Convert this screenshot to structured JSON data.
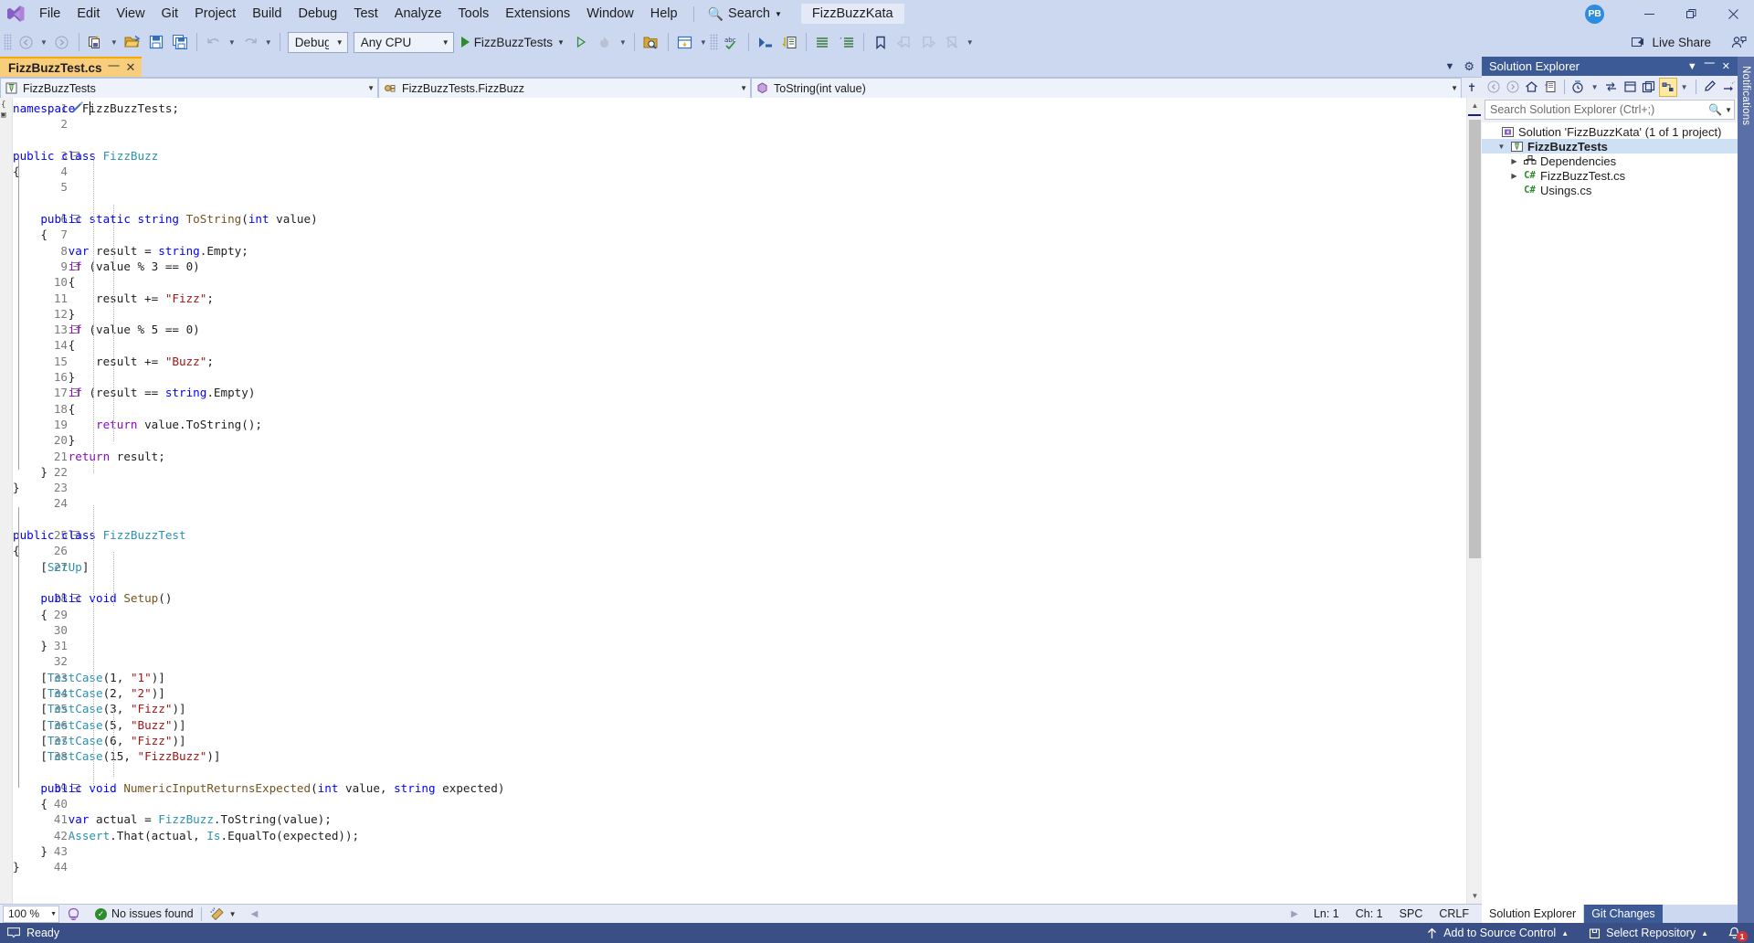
{
  "titlebar": {
    "logo_icon": "visual-studio-logo",
    "menus": [
      "File",
      "Edit",
      "View",
      "Git",
      "Project",
      "Build",
      "Debug",
      "Test",
      "Analyze",
      "Tools",
      "Extensions",
      "Window",
      "Help"
    ],
    "search": {
      "icon": "search-icon",
      "label": "Search",
      "caret": "▾"
    },
    "project_chip": "FizzBuzzKata",
    "avatar_initials": "PB",
    "window_controls": {
      "minimize": "—",
      "restore": "❐",
      "close": "✕"
    }
  },
  "toolbar": {
    "back_label": "◄",
    "forward_label": "►",
    "new_project_icon": "new-project-icon",
    "open_file_icon": "open-file-icon",
    "save_icon": "save-icon",
    "save_all_icon": "save-all-icon",
    "undo_icon": "undo-icon",
    "redo_icon": "redo-icon",
    "config_value": "Debug",
    "platform_value": "Any CPU",
    "start_label": "FizzBuzzTests",
    "start_icon": "play-icon",
    "start_no_debug_icon": "play-outline-icon",
    "hot_reload_icon": "hot-reload-icon",
    "find_in_files_icon": "find-in-files-icon",
    "window_layout_icon": "window-layout-icon",
    "spell_check_icon": "spell-check-icon",
    "step_icon": "step-into-icon",
    "indent_icon": "indent-icon",
    "comment_icon": "comment-icon",
    "uncomment_icon": "uncomment-icon",
    "bookmark_icon": "bookmark-icon",
    "bookmark_prev_icon": "bookmark-prev-icon",
    "bookmark_next_icon": "bookmark-next-icon",
    "bookmark_clear_icon": "bookmark-clear-icon",
    "overflow_label": "▾",
    "live_share": {
      "icon": "live-share-icon",
      "label": "Live Share",
      "participants_icon": "participants-icon"
    }
  },
  "editor": {
    "tab": {
      "title": "FizzBuzzTest.cs",
      "pin_icon": "pin-icon",
      "close_icon": "close-icon"
    },
    "tabstrip_right": {
      "dropdown_icon": "chevron-down-icon",
      "settings_icon": "gear-icon"
    },
    "navbar": {
      "project": {
        "icon": "project-icon",
        "value": "FizzBuzzTests"
      },
      "type": {
        "icon": "class-icon",
        "value": "FizzBuzzTests.FizzBuzz"
      },
      "member": {
        "icon": "method-icon",
        "value": "ToString(int value)"
      },
      "split_icon": "split-view-icon"
    },
    "caret_line": 1,
    "code_lines": [
      {
        "n": 1,
        "fold": null,
        "tokens": [
          [
            "kw",
            "namespace"
          ],
          [
            "plain",
            " FizzBuzzTests;"
          ]
        ]
      },
      {
        "n": 2,
        "fold": null,
        "tokens": []
      },
      {
        "n": "",
        "fold": null,
        "tokens": []
      },
      {
        "n": 3,
        "fold": "minus",
        "tokens": [
          [
            "kw",
            "public class "
          ],
          [
            "type",
            "FizzBuzz"
          ]
        ]
      },
      {
        "n": 4,
        "fold": null,
        "tokens": [
          [
            "plain",
            "{"
          ]
        ]
      },
      {
        "n": 5,
        "fold": null,
        "tokens": []
      },
      {
        "n": "",
        "fold": null,
        "tokens": []
      },
      {
        "n": 6,
        "fold": "minus",
        "tokens": [
          [
            "plain",
            "    "
          ],
          [
            "kw",
            "public static string "
          ],
          [
            "meth",
            "ToString"
          ],
          [
            "plain",
            "("
          ],
          [
            "kw",
            "int"
          ],
          [
            "plain",
            " value)"
          ]
        ]
      },
      {
        "n": 7,
        "fold": null,
        "tokens": [
          [
            "plain",
            "    {"
          ]
        ]
      },
      {
        "n": 8,
        "fold": null,
        "tokens": [
          [
            "plain",
            "        "
          ],
          [
            "kw",
            "var"
          ],
          [
            "plain",
            " result = "
          ],
          [
            "kw",
            "string"
          ],
          [
            "plain",
            ".Empty;"
          ]
        ]
      },
      {
        "n": 9,
        "fold": "minus",
        "tokens": [
          [
            "plain",
            "        "
          ],
          [
            "ctl",
            "if"
          ],
          [
            "plain",
            " (value % 3 == 0)"
          ]
        ]
      },
      {
        "n": 10,
        "fold": null,
        "tokens": [
          [
            "plain",
            "        {"
          ]
        ]
      },
      {
        "n": 11,
        "fold": null,
        "tokens": [
          [
            "plain",
            "            result += "
          ],
          [
            "str",
            "\"Fizz\""
          ],
          [
            "plain",
            ";"
          ]
        ]
      },
      {
        "n": 12,
        "fold": null,
        "tokens": [
          [
            "plain",
            "        }"
          ]
        ]
      },
      {
        "n": 13,
        "fold": "minus",
        "tokens": [
          [
            "plain",
            "        "
          ],
          [
            "ctl",
            "if"
          ],
          [
            "plain",
            " (value % 5 == 0)"
          ]
        ]
      },
      {
        "n": 14,
        "fold": null,
        "tokens": [
          [
            "plain",
            "        {"
          ]
        ]
      },
      {
        "n": 15,
        "fold": null,
        "tokens": [
          [
            "plain",
            "            result += "
          ],
          [
            "str",
            "\"Buzz\""
          ],
          [
            "plain",
            ";"
          ]
        ]
      },
      {
        "n": 16,
        "fold": null,
        "tokens": [
          [
            "plain",
            "        }"
          ]
        ]
      },
      {
        "n": 17,
        "fold": "minus",
        "tokens": [
          [
            "plain",
            "        "
          ],
          [
            "ctl",
            "if"
          ],
          [
            "plain",
            " (result == "
          ],
          [
            "kw",
            "string"
          ],
          [
            "plain",
            ".Empty)"
          ]
        ]
      },
      {
        "n": 18,
        "fold": null,
        "tokens": [
          [
            "plain",
            "        {"
          ]
        ]
      },
      {
        "n": 19,
        "fold": null,
        "tokens": [
          [
            "plain",
            "            "
          ],
          [
            "ctl",
            "return"
          ],
          [
            "plain",
            " value.ToString();"
          ]
        ]
      },
      {
        "n": 20,
        "fold": null,
        "tokens": [
          [
            "plain",
            "        }"
          ]
        ]
      },
      {
        "n": 21,
        "fold": null,
        "tokens": [
          [
            "plain",
            "        "
          ],
          [
            "ctl",
            "return"
          ],
          [
            "plain",
            " result;"
          ]
        ]
      },
      {
        "n": 22,
        "fold": null,
        "tokens": [
          [
            "plain",
            "    }"
          ]
        ]
      },
      {
        "n": 23,
        "fold": null,
        "tokens": [
          [
            "plain",
            "}"
          ]
        ]
      },
      {
        "n": 24,
        "fold": null,
        "tokens": []
      },
      {
        "n": "",
        "fold": null,
        "tokens": []
      },
      {
        "n": 25,
        "fold": "minus",
        "tokens": [
          [
            "kw",
            "public class "
          ],
          [
            "type",
            "FizzBuzzTest"
          ]
        ]
      },
      {
        "n": 26,
        "fold": null,
        "tokens": [
          [
            "plain",
            "{"
          ]
        ]
      },
      {
        "n": 27,
        "fold": null,
        "tokens": [
          [
            "plain",
            "    ["
          ],
          [
            "type",
            "SetUp"
          ],
          [
            "plain",
            "]"
          ]
        ]
      },
      {
        "n": "",
        "fold": null,
        "tokens": []
      },
      {
        "n": 28,
        "fold": "minus",
        "tokens": [
          [
            "plain",
            "    "
          ],
          [
            "kw",
            "public void "
          ],
          [
            "meth",
            "Setup"
          ],
          [
            "plain",
            "()"
          ]
        ]
      },
      {
        "n": 29,
        "fold": null,
        "tokens": [
          [
            "plain",
            "    {"
          ]
        ]
      },
      {
        "n": 30,
        "fold": null,
        "tokens": []
      },
      {
        "n": 31,
        "fold": null,
        "tokens": [
          [
            "plain",
            "    }"
          ]
        ]
      },
      {
        "n": 32,
        "fold": null,
        "tokens": []
      },
      {
        "n": 33,
        "fold": null,
        "tokens": [
          [
            "plain",
            "    ["
          ],
          [
            "type",
            "TestCase"
          ],
          [
            "plain",
            "(1, "
          ],
          [
            "str",
            "\"1\""
          ],
          [
            "plain",
            ")]"
          ]
        ]
      },
      {
        "n": 34,
        "fold": null,
        "tokens": [
          [
            "plain",
            "    ["
          ],
          [
            "type",
            "TestCase"
          ],
          [
            "plain",
            "(2, "
          ],
          [
            "str",
            "\"2\""
          ],
          [
            "plain",
            ")]"
          ]
        ]
      },
      {
        "n": 35,
        "fold": null,
        "tokens": [
          [
            "plain",
            "    ["
          ],
          [
            "type",
            "TestCase"
          ],
          [
            "plain",
            "(3, "
          ],
          [
            "str",
            "\"Fizz\""
          ],
          [
            "plain",
            ")]"
          ]
        ]
      },
      {
        "n": 36,
        "fold": null,
        "tokens": [
          [
            "plain",
            "    ["
          ],
          [
            "type",
            "TestCase"
          ],
          [
            "plain",
            "(5, "
          ],
          [
            "str",
            "\"Buzz\""
          ],
          [
            "plain",
            ")]"
          ]
        ]
      },
      {
        "n": 37,
        "fold": null,
        "tokens": [
          [
            "plain",
            "    ["
          ],
          [
            "type",
            "TestCase"
          ],
          [
            "plain",
            "(6, "
          ],
          [
            "str",
            "\"Fizz\""
          ],
          [
            "plain",
            ")]"
          ]
        ]
      },
      {
        "n": 38,
        "fold": null,
        "tokens": [
          [
            "plain",
            "    ["
          ],
          [
            "type",
            "TestCase"
          ],
          [
            "plain",
            "(15, "
          ],
          [
            "str",
            "\"FizzBuzz\""
          ],
          [
            "plain",
            ")]"
          ]
        ]
      },
      {
        "n": "",
        "fold": null,
        "tokens": []
      },
      {
        "n": 39,
        "fold": "minus",
        "tokens": [
          [
            "plain",
            "    "
          ],
          [
            "kw",
            "public void "
          ],
          [
            "meth",
            "NumericInputReturnsExpected"
          ],
          [
            "plain",
            "("
          ],
          [
            "kw",
            "int"
          ],
          [
            "plain",
            " value, "
          ],
          [
            "kw",
            "string"
          ],
          [
            "plain",
            " expected)"
          ]
        ]
      },
      {
        "n": 40,
        "fold": null,
        "tokens": [
          [
            "plain",
            "    {"
          ]
        ]
      },
      {
        "n": 41,
        "fold": null,
        "tokens": [
          [
            "plain",
            "        "
          ],
          [
            "kw",
            "var"
          ],
          [
            "plain",
            " actual = "
          ],
          [
            "type",
            "FizzBuzz"
          ],
          [
            "plain",
            ".ToString(value);"
          ]
        ]
      },
      {
        "n": 42,
        "fold": null,
        "tokens": [
          [
            "plain",
            "        "
          ],
          [
            "type",
            "Assert"
          ],
          [
            "plain",
            ".That(actual, "
          ],
          [
            "type",
            "Is"
          ],
          [
            "plain",
            ".EqualTo(expected));"
          ]
        ]
      },
      {
        "n": 43,
        "fold": null,
        "tokens": [
          [
            "plain",
            "    }"
          ]
        ]
      },
      {
        "n": 44,
        "fold": null,
        "tokens": [
          [
            "plain",
            "}"
          ]
        ]
      }
    ]
  },
  "editor_status": {
    "zoom": "100 %",
    "intellicode_icon": "intellicode-icon",
    "issues_icon": "check-icon",
    "issues_text": "No issues found",
    "cleanup_icon": "code-cleanup-icon",
    "line": "Ln: 1",
    "col": "Ch: 1",
    "spaces": "SPC",
    "eol": "CRLF"
  },
  "solution_explorer": {
    "title": "Solution Explorer",
    "header_icons": {
      "dropdown": "chevron-down-icon",
      "pin": "pin-icon",
      "close": "close-icon"
    },
    "toolbar_icons": [
      "back-icon",
      "forward-icon",
      "home-icon",
      "sync-with-active-document-icon",
      "pending-changes-filter-icon",
      "pending-changes-caret-icon",
      "collapse-all-icon",
      "show-all-files-icon",
      "new-folder-icon",
      "properties-icon",
      "properties-caret-icon",
      "preview-selected-items-icon",
      "solution-config-icon"
    ],
    "search_placeholder": "Search Solution Explorer (Ctrl+;)",
    "search_icon": "search-icon",
    "search_caret_icon": "chevron-down-icon",
    "tree": [
      {
        "depth": 0,
        "expander": "",
        "icon": "solution-icon",
        "label": "Solution 'FizzBuzzKata' (1 of 1 project)",
        "bold": false,
        "selected": false
      },
      {
        "depth": 1,
        "expander": "▾",
        "icon": "test-project-icon",
        "label": "FizzBuzzTests",
        "bold": true,
        "selected": true
      },
      {
        "depth": 2,
        "expander": "▸",
        "icon": "dependencies-icon",
        "label": "Dependencies",
        "bold": false,
        "selected": false
      },
      {
        "depth": 2,
        "expander": "▸",
        "icon": "csharp-file-icon",
        "label": "FizzBuzzTest.cs",
        "bold": false,
        "selected": false
      },
      {
        "depth": 2,
        "expander": "",
        "icon": "csharp-file-icon",
        "label": "Usings.cs",
        "bold": false,
        "selected": false
      }
    ],
    "bottom_tabs": [
      {
        "label": "Solution Explorer",
        "active": true
      },
      {
        "label": "Git Changes",
        "active": false
      }
    ]
  },
  "notifications_rail": {
    "label": "Notifications"
  },
  "statusbar": {
    "ready_icon": "ready-icon",
    "ready_text": "Ready",
    "add_to_source_control": {
      "icon": "up-arrow-icon",
      "label": "Add to Source Control",
      "caret": "▴"
    },
    "select_repository": {
      "icon": "repository-icon",
      "label": "Select Repository",
      "caret": "▴"
    },
    "notifications": {
      "icon": "bell-icon",
      "count": "1"
    }
  },
  "colors": {
    "chrome": "#ccd7f0",
    "accent_blue": "#3b4f87",
    "tab_active": "#f8cd7c",
    "keyword": "#0000ff",
    "type": "#2b91af",
    "string": "#a31515",
    "control": "#8f08c4",
    "method": "#74531f"
  }
}
